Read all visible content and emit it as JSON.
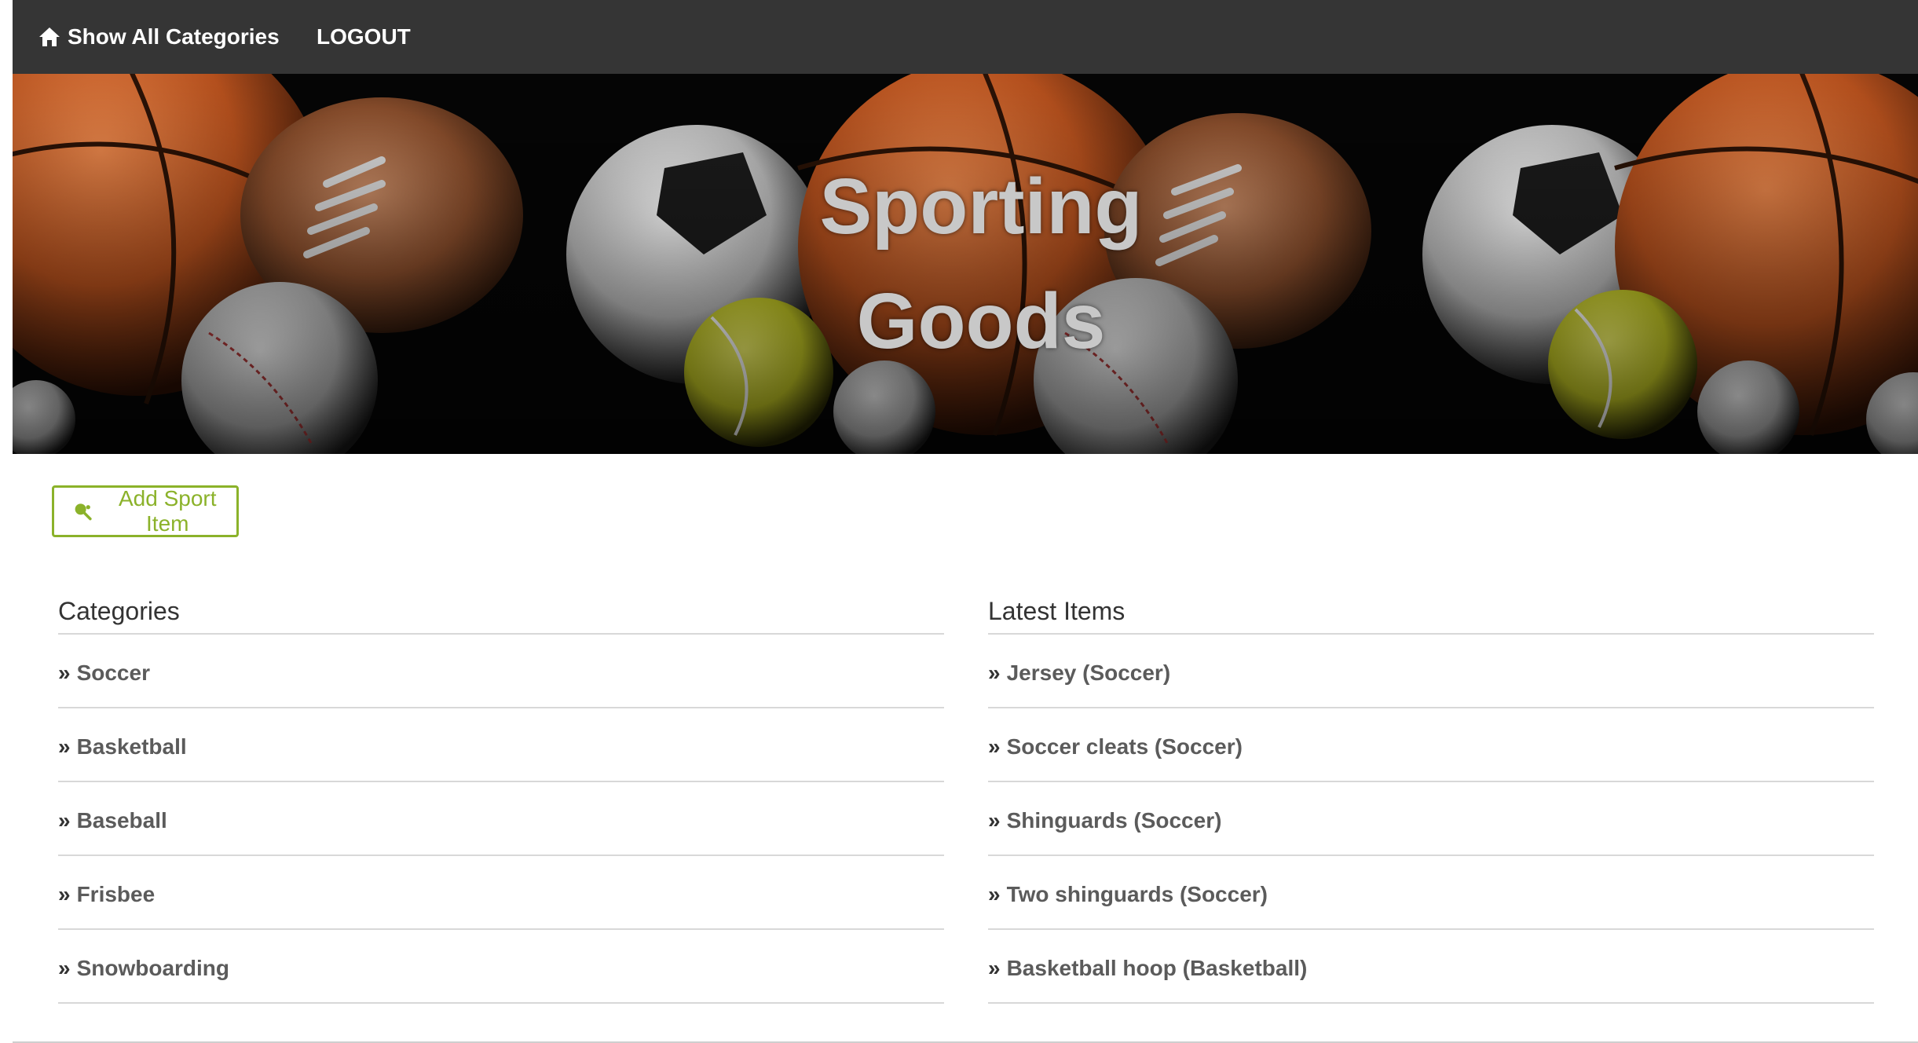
{
  "nav": {
    "home_label": "Show All Categories",
    "home_icon": "home-icon",
    "logout_label": "LOGOUT"
  },
  "banner": {
    "title_line1": "Sporting",
    "title_line2": "Goods"
  },
  "add_button": {
    "label": "Add Sport Item",
    "icon": "ping-pong-icon"
  },
  "categories": {
    "heading": "Categories",
    "items": [
      {
        "label": "Soccer"
      },
      {
        "label": "Basketball"
      },
      {
        "label": "Baseball"
      },
      {
        "label": "Frisbee"
      },
      {
        "label": "Snowboarding"
      }
    ]
  },
  "latest": {
    "heading": "Latest Items",
    "items": [
      {
        "label": "Jersey (Soccer)"
      },
      {
        "label": "Soccer cleats (Soccer)"
      },
      {
        "label": "Shinguards (Soccer)"
      },
      {
        "label": "Two shinguards (Soccer)"
      },
      {
        "label": "Basketball hoop (Basketball)"
      }
    ]
  },
  "colors": {
    "navbar": "#353535",
    "accent": "#8bb22a",
    "link_text": "#5b5b5b"
  }
}
